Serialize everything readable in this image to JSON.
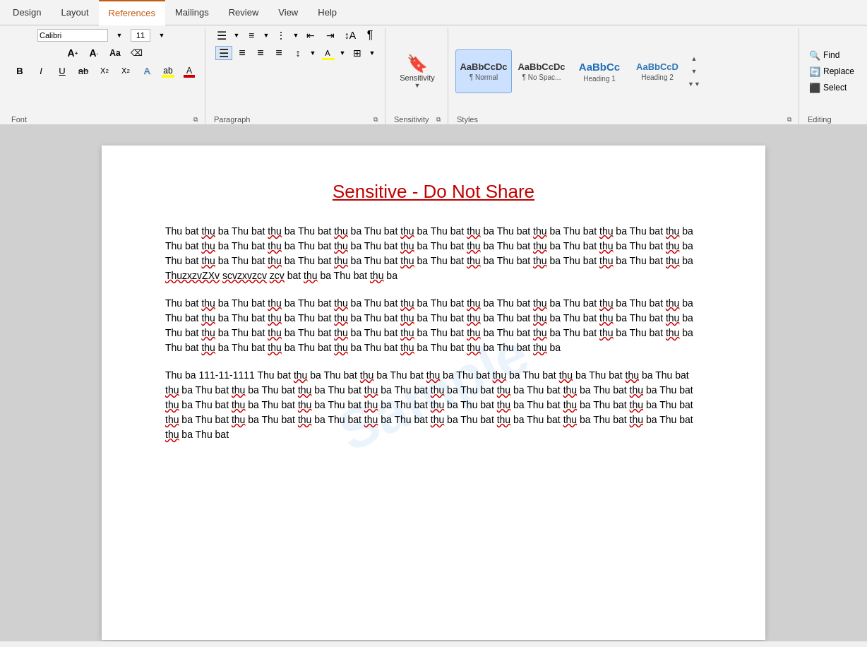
{
  "tabs": [
    {
      "label": "Design",
      "active": false
    },
    {
      "label": "Layout",
      "active": false
    },
    {
      "label": "References",
      "active": true
    },
    {
      "label": "Mailings",
      "active": false
    },
    {
      "label": "Review",
      "active": false
    },
    {
      "label": "View",
      "active": false
    },
    {
      "label": "Help",
      "active": false
    }
  ],
  "ribbon": {
    "paragraph_label": "Paragraph",
    "sensitivity_label": "Sensitivity",
    "styles_label": "Styles",
    "editing_label": "Editing",
    "sensitivity_btn": "Sensitivity",
    "find_label": "Find",
    "replace_label": "Replace",
    "select_label": "Select"
  },
  "styles": [
    {
      "id": "normal",
      "preview": "AaBbCcDc",
      "label": "¶ Normal",
      "active": true
    },
    {
      "id": "no-space",
      "preview": "AaBbCcDc",
      "label": "¶ No Spac...",
      "active": false
    },
    {
      "id": "heading1",
      "preview": "AaBbCc",
      "label": "Heading 1",
      "active": false
    },
    {
      "id": "heading2",
      "preview": "AaBbCcD",
      "label": "Heading 2",
      "active": false
    }
  ],
  "document": {
    "title": "Sensitive - Do Not Share",
    "watermark": "Sample",
    "paragraphs": [
      "Thu bat thu ba Thu bat thu ba Thu bat thu ba Thu bat thu ba Thu bat thu ba Thu bat thu ba Thu bat thu ba Thu bat thu ba Thu bat thu ba Thu bat thu ba Thu bat thu ba Thu bat thu ba Thu bat thu ba Thu bat thu ba Thu bat thu ba Thu bat thu ba Thu bat thu ba Thu bat thu ba Thu bat thu ba Thu bat thu ba Thu bat thu ba Thu bat thu ba Thu bat thu ba Thu bat thu ba Thu bat thu ba Thu bat thu ba Thu bat thu ba ThuzxzvZXv scvzxvzcv zcv bat thu ba Thu bat thu ba",
      "Thu bat thu ba Thu bat thu ba Thu bat thu ba Thu bat thu ba Thu bat thu ba Thu bat thu ba Thu bat thu ba Thu bat thu ba Thu bat thu ba Thu bat thu ba Thu bat thu ba Thu bat thu ba Thu bat thu ba Thu bat thu ba Thu bat thu ba Thu bat thu ba Thu bat thu ba Thu bat thu ba Thu bat thu ba Thu bat thu ba Thu bat thu ba Thu bat thu ba Thu bat thu ba Thu bat thu ba Thu bat thu ba Thu bat thu ba Thu bat thu ba Thu bat thu ba Thu bat thu ba Thu bat thu ba",
      "Thu ba 111-11-1111 Thu bat thu ba Thu bat thu ba Thu bat thu ba Thu bat thu ba Thu bat thu ba Thu bat thu ba Thu bat thu ba Thu bat thu ba Thu bat thu ba Thu bat thu ba Thu bat thu ba Thu bat thu ba Thu bat thu ba Thu bat thu ba Thu bat thu ba Thu bat thu ba Thu bat thu ba Thu bat thu ba Thu bat thu ba Thu bat thu ba Thu bat thu ba Thu bat thu ba Thu bat thu ba Thu bat thu ba Thu bat thu ba Thu bat"
    ]
  }
}
